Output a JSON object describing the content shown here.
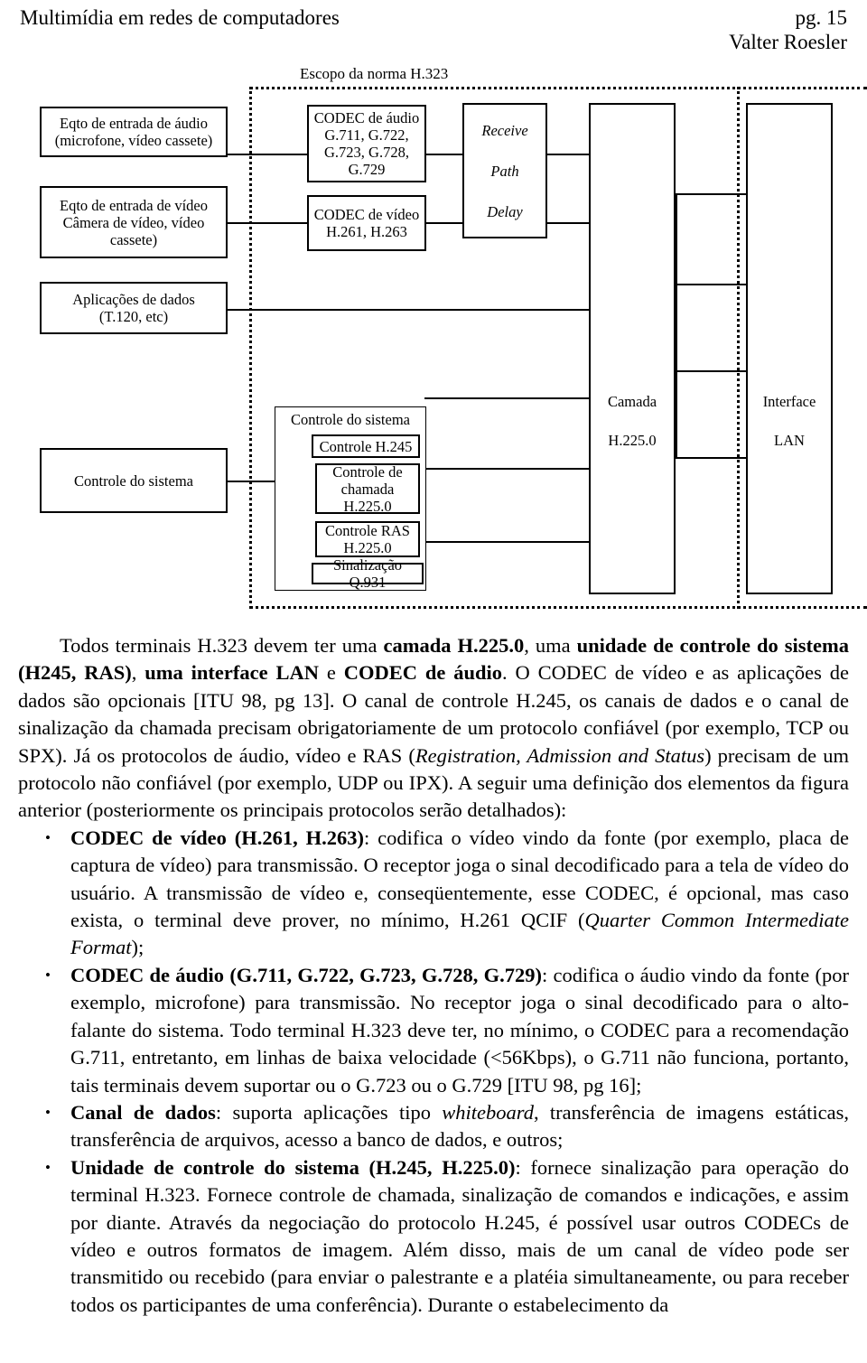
{
  "header": {
    "document_title": "Multimídia em redes de computadores",
    "page_label": "pg. 15",
    "author": "Valter Roesler"
  },
  "figure": {
    "caption": "Escopo da norma H.323",
    "boxes": {
      "audio_input": "Eqto de entrada de áudio (microfone, vídeo cassete)",
      "audio_input_l1": "Eqto de entrada de áudio",
      "audio_input_l2": "(microfone, vídeo cassete)",
      "video_input_l1": "Eqto de entrada de vídeo",
      "video_input_l2": "Câmera de vídeo, vídeo",
      "video_input_l3": "cassete)",
      "data_apps_l1": "Aplicações de dados",
      "data_apps_l2": "(T.120, etc)",
      "system_control_left": "Controle do sistema",
      "audio_codec_l1": "CODEC de áudio",
      "audio_codec_l2": "G.711, G.722,",
      "audio_codec_l3": "G.723, G.728, G.729",
      "video_codec_l1": "CODEC de vídeo",
      "video_codec_l2": "H.261, H.263",
      "receive_path_l1": "Receive",
      "receive_path_l2": "Path",
      "receive_path_l3": "Delay",
      "system_control_group": "Controle do sistema",
      "control_h245": "Controle H.245",
      "call_control_l1": "Controle de",
      "call_control_l2": "chamada",
      "call_control_l3": "H.225.0",
      "ras_control_l1": "Controle RAS",
      "ras_control_l2": "H.225.0",
      "signaling_q931": "Sinalização Q.931",
      "layer_l1": "Camada",
      "layer_l2": "H.225.0",
      "interface_l1": "Interface",
      "interface_l2": "LAN"
    }
  },
  "body": {
    "paragraph_1": {
      "seg_1": "Todos terminais H.323 devem ter uma ",
      "bold_1": "camada H.225.0",
      "seg_2": ", uma ",
      "bold_2": "unidade de controle do sistema (H245, RAS)",
      "seg_3": ", ",
      "bold_3": "uma interface LAN",
      "seg_4": " e ",
      "bold_4": "CODEC de áudio",
      "seg_5": ". O CODEC de vídeo e as aplicações de dados são opcionais [ITU 98, pg 13]. O canal de controle H.245, os canais de dados e o canal de sinalização da chamada precisam obrigatoriamente de um protocolo confiável (por exemplo, TCP ou SPX). Já os protocolos de áudio, vídeo e RAS (",
      "italic_1": "Registration, Admission and Status",
      "seg_6": ") precisam de um protocolo não confiável (por exemplo, UDP ou IPX). A seguir uma definição dos elementos da figura anterior (posteriormente os principais protocolos serão detalhados):"
    },
    "bullets": [
      {
        "bullet": "•",
        "bold_lead": "CODEC de vídeo (H.261, H.263)",
        "text_1": ": codifica o vídeo vindo da fonte (por exemplo, placa de captura de vídeo) para transmissão. O receptor joga o sinal decodificado para a tela de vídeo do usuário. A transmissão de vídeo e, conseqüentemente, esse CODEC, é opcional, mas caso exista, o terminal deve prover, no mínimo, H.261 QCIF (",
        "italic_1": "Quarter Common Intermediate Format",
        "text_2": ");"
      },
      {
        "bullet": "•",
        "bold_lead": "CODEC de áudio (G.711, G.722, G.723, G.728, G.729)",
        "text_1": ": codifica o áudio vindo da fonte (por exemplo, microfone) para transmissão. No receptor joga o sinal decodificado para o alto-falante do sistema. Todo terminal H.323 deve ter, no mínimo, o CODEC para a recomendação G.711, entretanto, em linhas de baixa velocidade (<56Kbps), o G.711 não funciona, portanto, tais terminais devem suportar ou o G.723 ou o G.729 [ITU 98, pg 16];",
        "italic_1": "",
        "text_2": ""
      },
      {
        "bullet": "•",
        "bold_lead": "Canal de dados",
        "text_1": ": suporta aplicações tipo ",
        "italic_1": "whiteboard",
        "text_2": ", transferência de imagens estáticas, transferência de arquivos, acesso a banco de dados, e outros;"
      },
      {
        "bullet": "•",
        "bold_lead": "Unidade de controle do sistema (H.245, H.225.0)",
        "text_1": ": fornece sinalização para operação do terminal H.323. Fornece controle de chamada, sinalização de comandos e indicações, e assim por diante. Através da negociação do protocolo H.245, é possível usar outros CODECs de vídeo e outros formatos de imagem. Além disso, mais de um canal de vídeo pode ser transmitido ou recebido (para enviar o palestrante e a platéia simultaneamente, ou para receber todos os participantes de uma conferência). Durante o estabelecimento da",
        "italic_1": "",
        "text_2": ""
      }
    ]
  }
}
